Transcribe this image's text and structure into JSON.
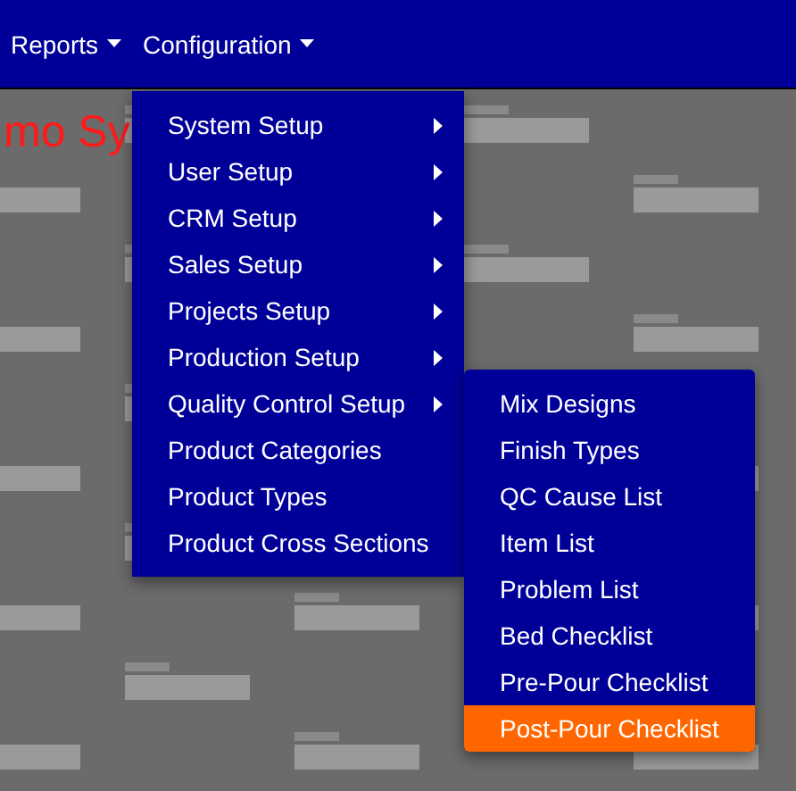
{
  "navbar": {
    "menus": [
      {
        "label": "Reports"
      },
      {
        "label": "Configuration"
      }
    ]
  },
  "page_heading": "mo Sy",
  "configuration_menu": [
    {
      "label": "System Setup",
      "kind": "submenu"
    },
    {
      "label": "User Setup",
      "kind": "submenu"
    },
    {
      "label": "CRM Setup",
      "kind": "submenu"
    },
    {
      "label": "Sales Setup",
      "kind": "submenu"
    },
    {
      "label": "Projects Setup",
      "kind": "submenu"
    },
    {
      "label": "Production Setup",
      "kind": "submenu"
    },
    {
      "label": "Quality Control Setup",
      "kind": "submenu"
    },
    {
      "label": "Product Categories",
      "kind": "link"
    },
    {
      "label": "Product Types",
      "kind": "link"
    },
    {
      "label": "Product Cross Sections",
      "kind": "link"
    }
  ],
  "quality_control_submenu": [
    {
      "label": "Mix Designs",
      "selected": false
    },
    {
      "label": "Finish Types",
      "selected": false
    },
    {
      "label": "QC Cause List",
      "selected": false
    },
    {
      "label": "Item List",
      "selected": false
    },
    {
      "label": "Problem List",
      "selected": false
    },
    {
      "label": "Bed Checklist",
      "selected": false
    },
    {
      "label": "Pre-Pour Checklist",
      "selected": false
    },
    {
      "label": "Post-Pour Checklist",
      "selected": true
    }
  ]
}
